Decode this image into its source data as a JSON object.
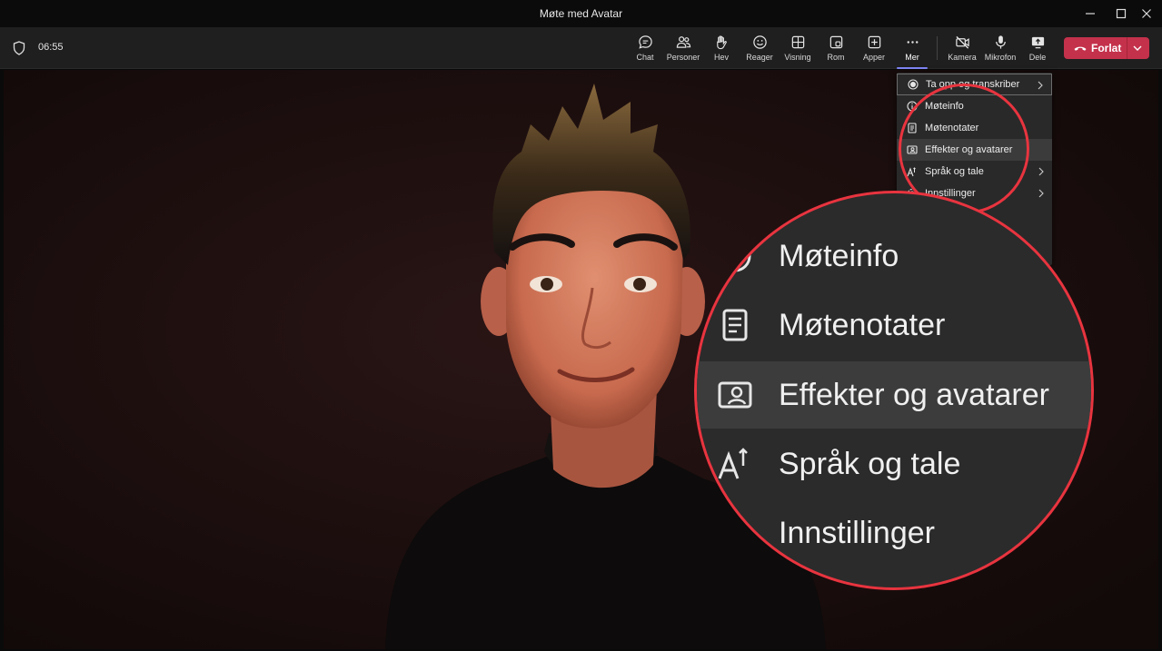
{
  "window": {
    "title": "Møte med Avatar"
  },
  "meeting": {
    "elapsed": "06:55"
  },
  "toolbar": {
    "buttons": [
      {
        "id": "chat",
        "label": "Chat",
        "icon": "chat-icon"
      },
      {
        "id": "people",
        "label": "Personer",
        "icon": "people-icon"
      },
      {
        "id": "raise",
        "label": "Hev",
        "icon": "raise-hand-icon"
      },
      {
        "id": "react",
        "label": "Reager",
        "icon": "smiley-icon"
      },
      {
        "id": "view",
        "label": "Visning",
        "icon": "grid-view-icon"
      },
      {
        "id": "rooms",
        "label": "Rom",
        "icon": "breakout-rooms-icon"
      },
      {
        "id": "apps",
        "label": "Apper",
        "icon": "add-apps-icon"
      },
      {
        "id": "more",
        "label": "Mer",
        "icon": "more-dots-icon",
        "active": true
      },
      {
        "id": "camera",
        "label": "Kamera",
        "icon": "camera-off-icon"
      },
      {
        "id": "mic",
        "label": "Mikrofon",
        "icon": "microphone-icon"
      },
      {
        "id": "share",
        "label": "Dele",
        "icon": "share-screen-icon"
      }
    ],
    "leave_label": "Forlat"
  },
  "more_menu": {
    "items": [
      {
        "label": "Ta opp og transkriber",
        "icon": "record-icon",
        "submenu": true
      },
      {
        "label": "Møteinfo",
        "icon": "info-icon",
        "submenu": false
      },
      {
        "label": "Møtenotater",
        "icon": "notes-icon",
        "submenu": false
      },
      {
        "label": "Effekter og avatarer",
        "icon": "effects-avatar-icon",
        "submenu": false,
        "hovered": true
      },
      {
        "label": "Språk og tale",
        "icon": "language-icon",
        "submenu": true
      },
      {
        "label": "Innstillinger",
        "icon": "settings-icon",
        "submenu": true
      }
    ]
  },
  "zoom_callout": {
    "items": [
      {
        "label": "Møteinfo"
      },
      {
        "label": "Møtenotater"
      },
      {
        "label": "Effekter og avatarer"
      },
      {
        "label": "Språk og tale"
      },
      {
        "label": "Innstillinger"
      }
    ]
  },
  "colors": {
    "leave_button": "#c4314b",
    "highlight_circle": "#e8343f",
    "active_indicator": "#7f85f5",
    "stage_background": "#1a0f0f"
  }
}
